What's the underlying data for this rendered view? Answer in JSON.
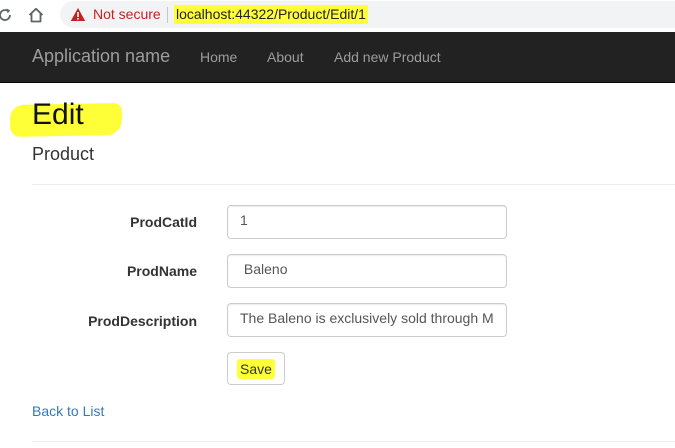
{
  "browser": {
    "security_label": "Not secure",
    "url": "localhost:44322/Product/Edit/1"
  },
  "navbar": {
    "brand": "Application name",
    "links": [
      "Home",
      "About",
      "Add new Product"
    ]
  },
  "page": {
    "title": "Edit",
    "subtitle": "Product"
  },
  "form": {
    "fields": [
      {
        "label": "ProdCatId",
        "value": "1"
      },
      {
        "label": "ProdName",
        "value": " Baleno"
      },
      {
        "label": "ProdDescription",
        "value": "The Baleno is exclusively sold through M"
      }
    ],
    "save_label": "Save"
  },
  "footer": {
    "back_link": "Back to List"
  },
  "colors": {
    "highlight": "#ffff38",
    "navbar_bg": "#222222",
    "link": "#337ab7",
    "warning": "#c5221f"
  },
  "icons": [
    "reload-icon",
    "home-icon",
    "warning-icon"
  ]
}
